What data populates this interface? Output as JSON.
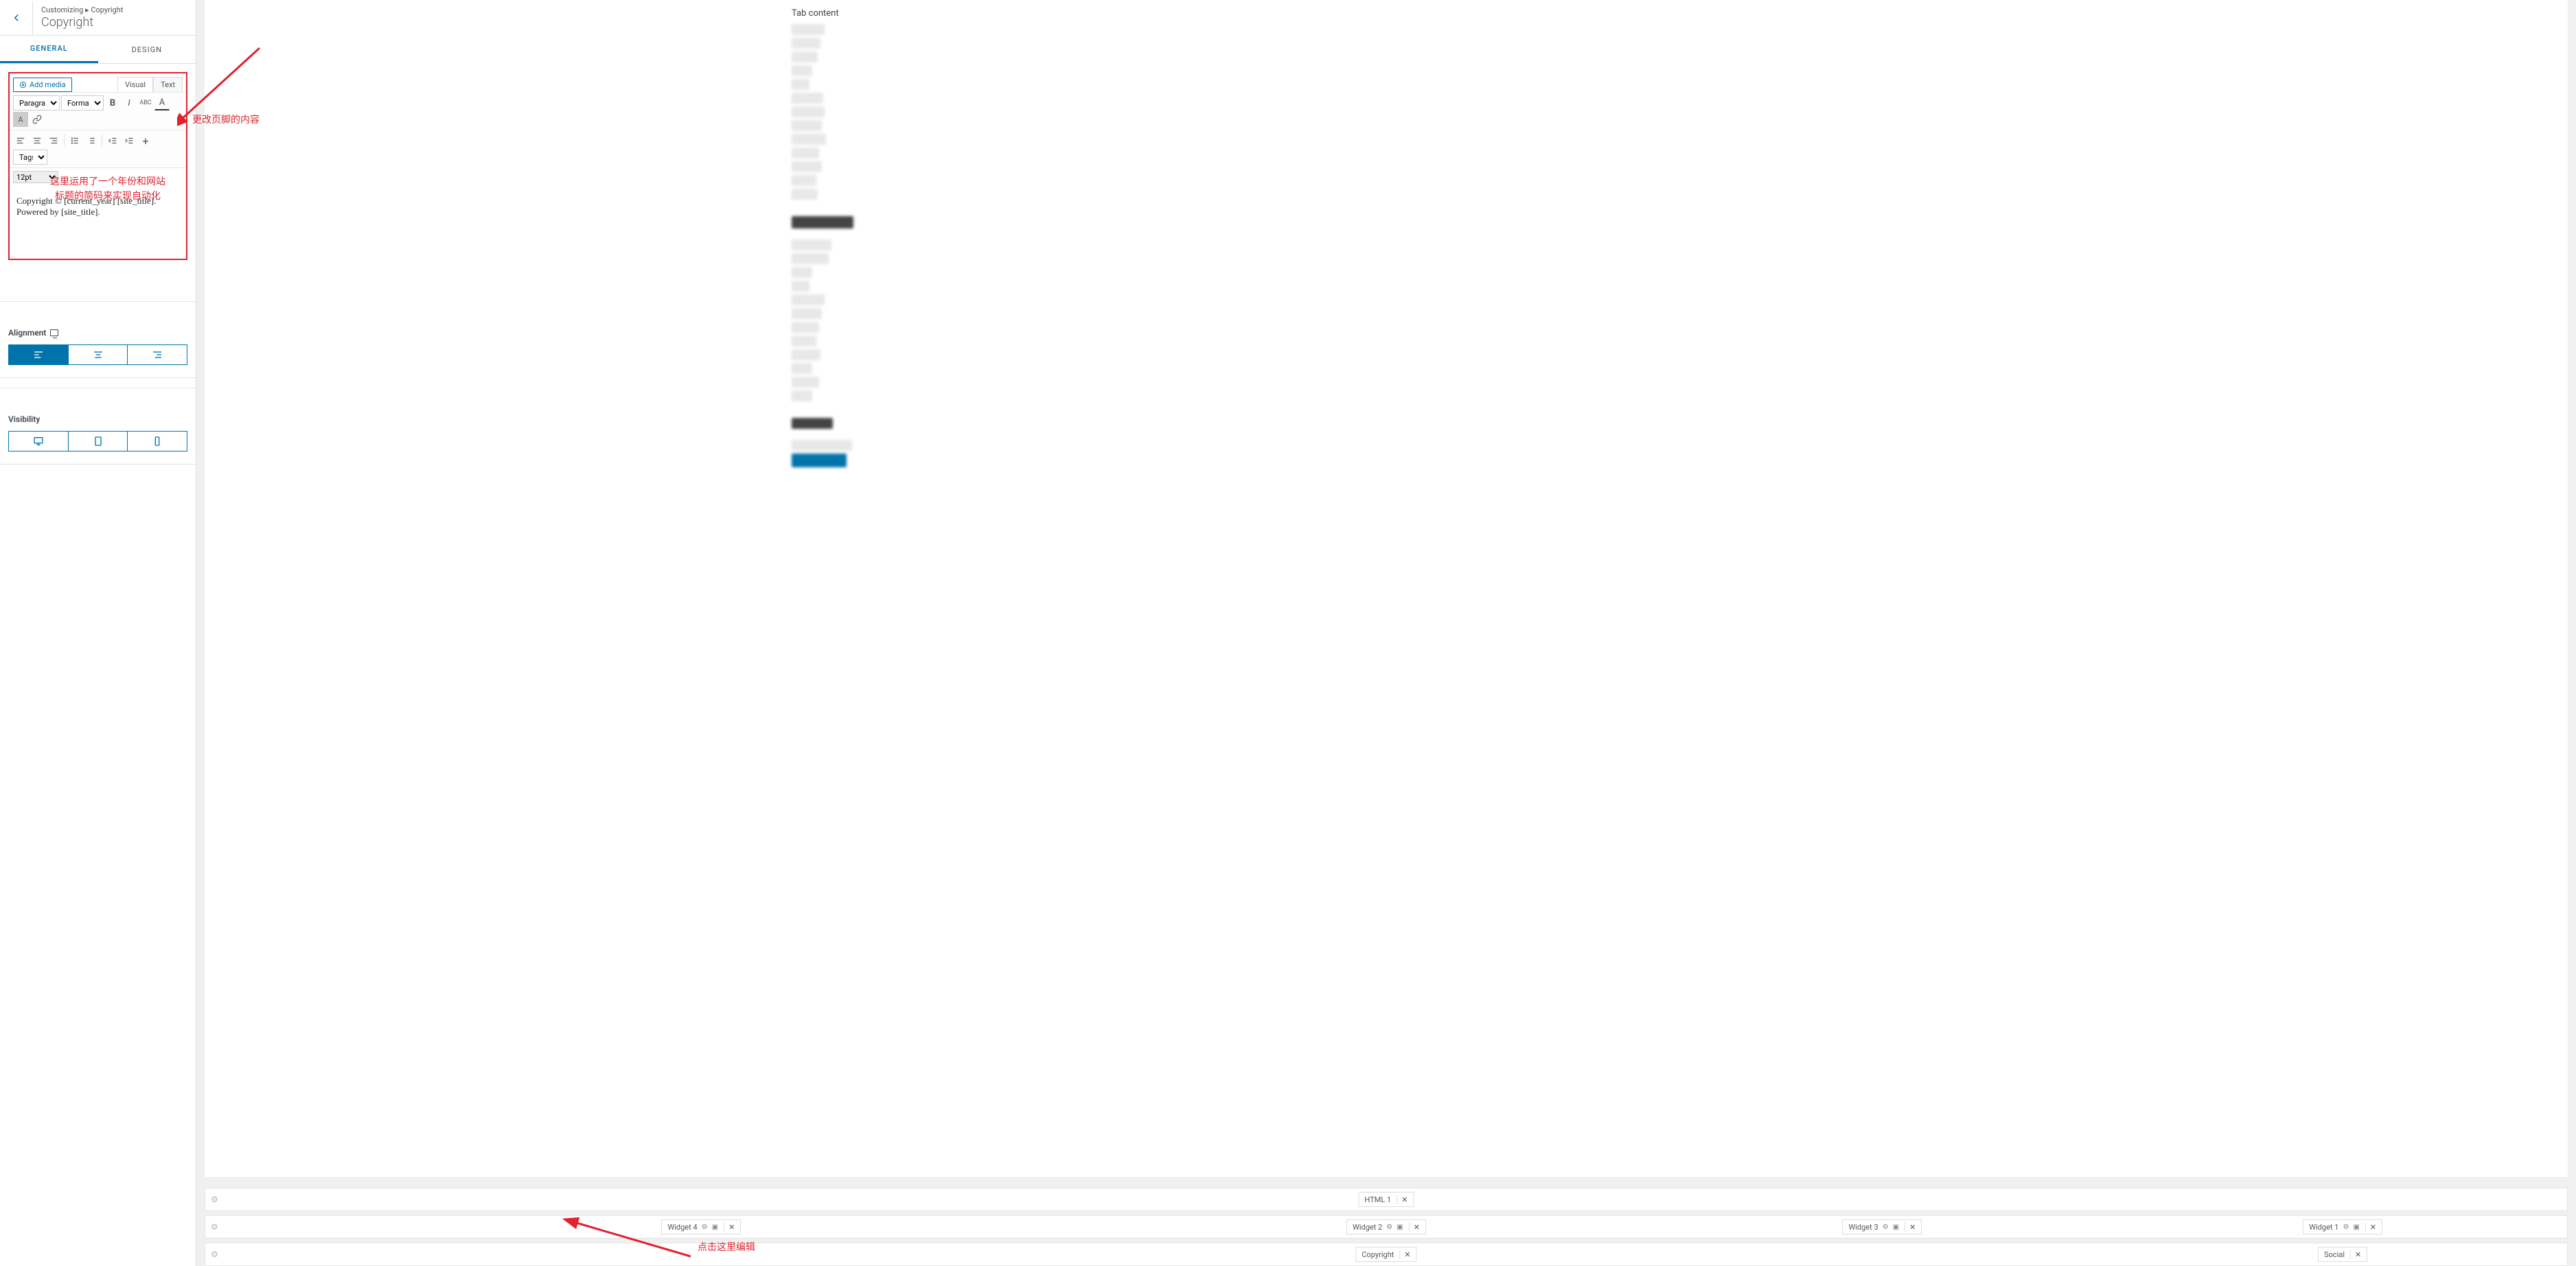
{
  "header": {
    "breadcrumb": "Customizing ▸ Copyright",
    "title": "Copyright"
  },
  "tabs": {
    "general": "GENERAL",
    "design": "DESIGN"
  },
  "editor": {
    "add_media": "Add media",
    "visual": "Visual",
    "text": "Text",
    "paragraph": "Paragraph",
    "formats": "Formats",
    "tags": "Tags",
    "fontsize": "12pt",
    "content": "Copyright © [current_year] [site_title]. Powered by [site_title]."
  },
  "annotations": {
    "a1": "更改页脚的内容",
    "a2_line1": "这里运用了一个年份和网站",
    "a2_line2": "标题的简码来实现自动化",
    "a3": "点击这里编辑"
  },
  "sections": {
    "alignment": "Alignment",
    "visibility": "Visibility"
  },
  "preview": {
    "tab_content": "Tab content"
  },
  "footer_rows": {
    "html1": "HTML 1",
    "widget4": "Widget 4",
    "widget2": "Widget 2",
    "widget3": "Widget 3",
    "widget1": "Widget 1",
    "copyright": "Copyright",
    "social": "Social"
  }
}
